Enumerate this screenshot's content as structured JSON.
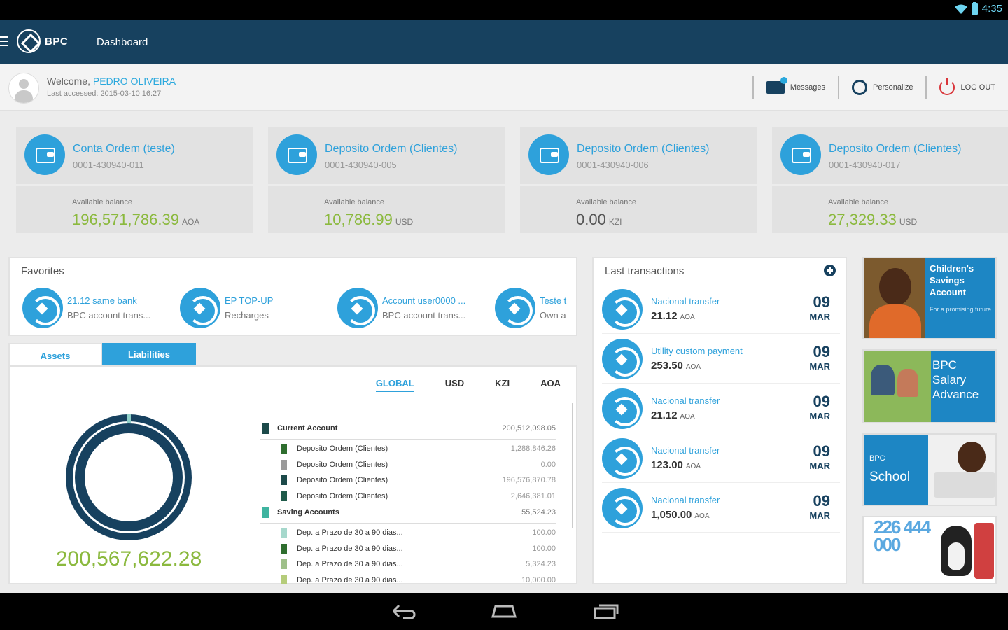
{
  "status_bar": {
    "time": "4:35"
  },
  "app": {
    "brand": "BPC",
    "title": "Dashboard"
  },
  "welcome": {
    "greeting": "Welcome,",
    "user_name": "PEDRO OLIVEIRA",
    "last_accessed_label": "Last accessed:",
    "last_accessed_value": "2015-03-10 16:27"
  },
  "header_actions": {
    "messages": "Messages",
    "personalize": "Personalize",
    "logout": "LOG OUT"
  },
  "accounts": [
    {
      "name": "Conta Ordem (teste)",
      "number": "0001-430940-011",
      "balance_label": "Available balance",
      "balance": "196,571,786.39",
      "currency": "AOA"
    },
    {
      "name": "Deposito Ordem (Clientes)",
      "number": "0001-430940-005",
      "balance_label": "Available balance",
      "balance": "10,786.99",
      "currency": "USD"
    },
    {
      "name": "Deposito Ordem (Clientes)",
      "number": "0001-430940-006",
      "balance_label": "Available balance",
      "balance": "0.00",
      "currency": "KZI"
    },
    {
      "name": "Deposito Ordem (Clientes)",
      "number": "0001-430940-017",
      "balance_label": "Available balance",
      "balance": "27,329.33",
      "currency": "USD"
    }
  ],
  "favorites": {
    "title": "Favorites",
    "items": [
      {
        "title": "21.12 same bank",
        "subtitle": "BPC account trans..."
      },
      {
        "title": "EP TOP-UP",
        "subtitle": "Recharges"
      },
      {
        "title": "Account user0000 ...",
        "subtitle": "BPC account trans..."
      },
      {
        "title": "Teste t",
        "subtitle": "Own a"
      }
    ]
  },
  "portfolio": {
    "tabs": [
      "Assets",
      "Liabilities"
    ],
    "currency_tabs": [
      "GLOBAL",
      "USD",
      "KZI",
      "AOA"
    ],
    "active_currency": "GLOBAL",
    "total": "200,567,622.28",
    "donut": {
      "outer_color": "#17415f",
      "ring_color": "#17415f",
      "highlight_color": "#8fd0c8"
    },
    "groups": [
      {
        "label": "Current Account",
        "value": "200,512,098.05",
        "color": "#1c4a4a"
      },
      {
        "label": "Deposito Ordem (Clientes)",
        "value": "1,288,846.26",
        "color": "#2f6e2f",
        "sub": true
      },
      {
        "label": "Deposito Ordem (Clientes)",
        "value": "0.00",
        "color": "#9a9a9a",
        "sub": true
      },
      {
        "label": "Deposito Ordem (Clientes)",
        "value": "196,576,870.78",
        "color": "#1c4a4a",
        "sub": true
      },
      {
        "label": "Deposito Ordem (Clientes)",
        "value": "2,646,381.01",
        "color": "#1f5a4a",
        "sub": true
      },
      {
        "label": "Saving Accounts",
        "value": "55,524.23",
        "color": "#3fb4a0"
      },
      {
        "label": "Dep. a Prazo de  30 a  90 dias...",
        "value": "100.00",
        "color": "#a6d8cc",
        "sub": true
      },
      {
        "label": "Dep. a Prazo de  30 a  90 dias...",
        "value": "100.00",
        "color": "#2f6e2f",
        "sub": true
      },
      {
        "label": "Dep. a Prazo de  30 a  90 dias...",
        "value": "5,324.23",
        "color": "#9fc08a",
        "sub": true
      },
      {
        "label": "Dep. a Prazo de  30 a  90 dias...",
        "value": "10,000.00",
        "color": "#b5cc7a",
        "sub": true
      }
    ]
  },
  "last_transactions": {
    "title": "Last transactions",
    "items": [
      {
        "type": "Nacional transfer",
        "amount": "21.12",
        "currency": "AOA",
        "day": "09",
        "month": "MAR"
      },
      {
        "type": "Utility custom payment",
        "amount": "253.50",
        "currency": "AOA",
        "day": "09",
        "month": "MAR"
      },
      {
        "type": "Nacional transfer",
        "amount": "21.12",
        "currency": "AOA",
        "day": "09",
        "month": "MAR"
      },
      {
        "type": "Nacional transfer",
        "amount": "123.00",
        "currency": "AOA",
        "day": "09",
        "month": "MAR"
      },
      {
        "type": "Nacional transfer",
        "amount": "1,050.00",
        "currency": "AOA",
        "day": "09",
        "month": "MAR"
      }
    ]
  },
  "promos": [
    {
      "lines": [
        "Children's",
        "Savings",
        "Account"
      ],
      "tagline": "For a promising future"
    },
    {
      "lines": [
        "BPC",
        "Salary",
        "Advance"
      ]
    },
    {
      "lines": [
        "BPC",
        "School"
      ]
    },
    {
      "text": "226 444 000"
    }
  ],
  "colors": {
    "primary": "#17415f",
    "accent": "#2ea1db",
    "positive": "#8bb93e",
    "logout": "#d9353a"
  }
}
